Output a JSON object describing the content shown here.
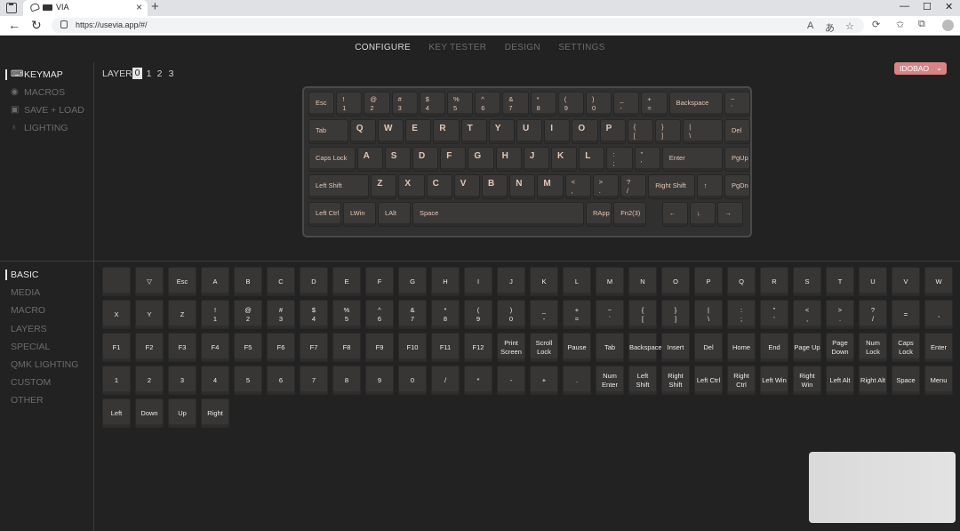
{
  "browser": {
    "tab_title": "VIA",
    "url": "https://usevia.app/#/"
  },
  "topnav": [
    "CONFIGURE",
    "KEY TESTER",
    "DESIGN",
    "SETTINGS"
  ],
  "sidebar_top": [
    {
      "label": "KEYMAP",
      "icon": "keyboard-icon"
    },
    {
      "label": "MACROS",
      "icon": "circle-dot-icon"
    },
    {
      "label": "SAVE + LOAD",
      "icon": "save-icon"
    },
    {
      "label": "LIGHTING",
      "icon": "bulb-icon"
    }
  ],
  "layer": {
    "label": "LAYER",
    "numbers": [
      "0",
      "1",
      "2",
      "3"
    ],
    "active": "0"
  },
  "keyboard_name": "IDOBAO",
  "keyboard_rows": [
    [
      {
        "t": "Esc",
        "w": 1
      },
      {
        "t": "!",
        "b": "1"
      },
      {
        "t": "@",
        "b": "2"
      },
      {
        "t": "#",
        "b": "3"
      },
      {
        "t": "$",
        "b": "4"
      },
      {
        "t": "%",
        "b": "5"
      },
      {
        "t": "^",
        "b": "6"
      },
      {
        "t": "&",
        "b": "7"
      },
      {
        "t": "*",
        "b": "8"
      },
      {
        "t": "(",
        "b": "9"
      },
      {
        "t": ")",
        "b": "0"
      },
      {
        "t": "_",
        "b": "-"
      },
      {
        "t": "+",
        "b": "="
      },
      {
        "t": "Backspace",
        "w": 2
      },
      {
        "t": "~",
        "b": "`"
      }
    ],
    [
      {
        "t": "Tab",
        "w": 1.5
      },
      {
        "k": "Q"
      },
      {
        "k": "W"
      },
      {
        "k": "E"
      },
      {
        "k": "R"
      },
      {
        "k": "T"
      },
      {
        "k": "Y"
      },
      {
        "k": "U"
      },
      {
        "k": "I"
      },
      {
        "k": "O"
      },
      {
        "k": "P"
      },
      {
        "t": "{",
        "b": "["
      },
      {
        "t": "}",
        "b": "]"
      },
      {
        "t": "|",
        "b": "\\",
        "w": 1.5
      },
      {
        "t": "Del"
      }
    ],
    [
      {
        "t": "Caps Lock",
        "w": 1.75
      },
      {
        "k": "A"
      },
      {
        "k": "S"
      },
      {
        "k": "D"
      },
      {
        "k": "F"
      },
      {
        "k": "G"
      },
      {
        "k": "H"
      },
      {
        "k": "J"
      },
      {
        "k": "K"
      },
      {
        "k": "L"
      },
      {
        "t": ":",
        "b": ";"
      },
      {
        "t": "\"",
        "b": "'"
      },
      {
        "t": "Enter",
        "w": 2.25
      },
      {
        "t": "PgUp"
      }
    ],
    [
      {
        "t": "Left Shift",
        "w": 2.25
      },
      {
        "k": "Z"
      },
      {
        "k": "X"
      },
      {
        "k": "C"
      },
      {
        "k": "V"
      },
      {
        "k": "B"
      },
      {
        "k": "N"
      },
      {
        "k": "M"
      },
      {
        "t": "<",
        "b": ","
      },
      {
        "t": ">",
        "b": "."
      },
      {
        "t": "?",
        "b": "/"
      },
      {
        "t": "Right Shift",
        "w": 1.75
      },
      {
        "t": "↑"
      },
      {
        "t": "PgDn"
      }
    ],
    [
      {
        "t": "Left Ctrl",
        "w": 1.25
      },
      {
        "t": "LWin",
        "w": 1.25
      },
      {
        "t": "LAlt",
        "w": 1.25
      },
      {
        "t": "Space",
        "w": 6.25
      },
      {
        "t": "RApp"
      },
      {
        "t": "Fn2(3)",
        "w": 1.25
      },
      {
        "gap": 0.5
      },
      {
        "t": "←"
      },
      {
        "t": "↓"
      },
      {
        "t": "→"
      }
    ]
  ],
  "sidebar_bottom": [
    "BASIC",
    "MEDIA",
    "MACRO",
    "LAYERS",
    "SPECIAL",
    "QMK LIGHTING",
    "CUSTOM",
    "OTHER"
  ],
  "palette_rows": [
    [
      "",
      "▽",
      "Esc",
      "A",
      "B",
      "C",
      "D",
      "E",
      "F",
      "G",
      "H",
      "I",
      "J",
      "K",
      "L",
      "M",
      "N",
      "O",
      "P",
      "Q",
      "R",
      "S",
      "T",
      "U",
      "V",
      "W"
    ],
    [
      "X",
      "Y",
      "Z",
      "!\n1",
      "@\n2",
      "#\n3",
      "$\n4",
      "%\n5",
      "^\n6",
      "&\n7",
      "*\n8",
      "(\n9",
      ")\n0",
      "_\n-",
      "+\n=",
      "~\n`",
      "{\n[",
      "}\n]",
      "|\n\\",
      ":\n;",
      "\"\n'",
      "<\n,",
      ">\n.",
      "?\n/",
      "=",
      ","
    ],
    [
      "F1",
      "F2",
      "F3",
      "F4",
      "F5",
      "F6",
      "F7",
      "F8",
      "F9",
      "F10",
      "F11",
      "F12",
      "Print\nScreen",
      "Scroll\nLock",
      "Pause",
      "Tab",
      "Backspace",
      "Insert",
      "Del",
      "Home",
      "End",
      "Page Up",
      "Page\nDown",
      "Num\nLock",
      "Caps\nLock",
      "Enter"
    ],
    [
      "1",
      "2",
      "3",
      "4",
      "5",
      "6",
      "7",
      "8",
      "9",
      "0",
      "/",
      "*",
      "-",
      "+",
      ".",
      "Num\nEnter",
      "Left\nShift",
      "Right\nShift",
      "Left Ctrl",
      "Right\nCtrl",
      "Left Win",
      "Right\nWin",
      "Left Alt",
      "Right Alt",
      "Space",
      "Menu"
    ],
    [
      "Left",
      "Down",
      "Up",
      "Right"
    ]
  ]
}
